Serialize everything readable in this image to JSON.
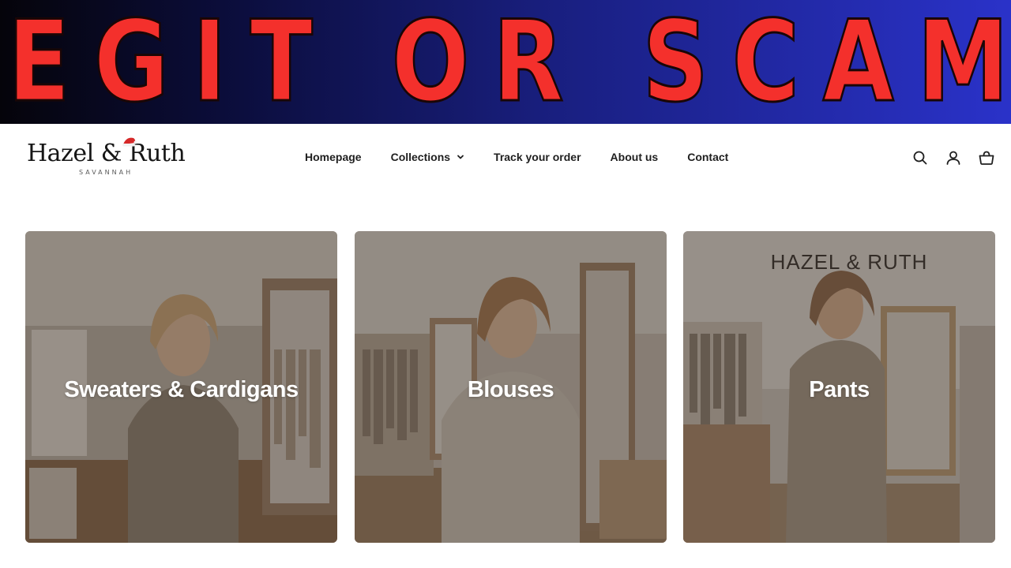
{
  "banner": {
    "title": "LEGIT OR SCAM?"
  },
  "header": {
    "logo_text": "Hazel & Ruth",
    "logo_subtext": "SAVANNAH",
    "nav": [
      {
        "label": "Homepage"
      },
      {
        "label": "Collections",
        "has_dropdown": true
      },
      {
        "label": "Track your order"
      },
      {
        "label": "About us"
      },
      {
        "label": "Contact"
      }
    ],
    "icons": [
      "search-icon",
      "account-icon",
      "cart-icon"
    ]
  },
  "collections": [
    {
      "label": "Sweaters & Cardigans"
    },
    {
      "label": "Blouses"
    },
    {
      "label": "Pants",
      "store_sign": "HAZEL & RUTH"
    }
  ],
  "colors": {
    "banner_text": "#f4302c",
    "banner_gradient_start": "#05040a",
    "banner_gradient_end": "#2a32c9",
    "nav_text": "#1f1f1f",
    "card_label": "#ffffff"
  }
}
